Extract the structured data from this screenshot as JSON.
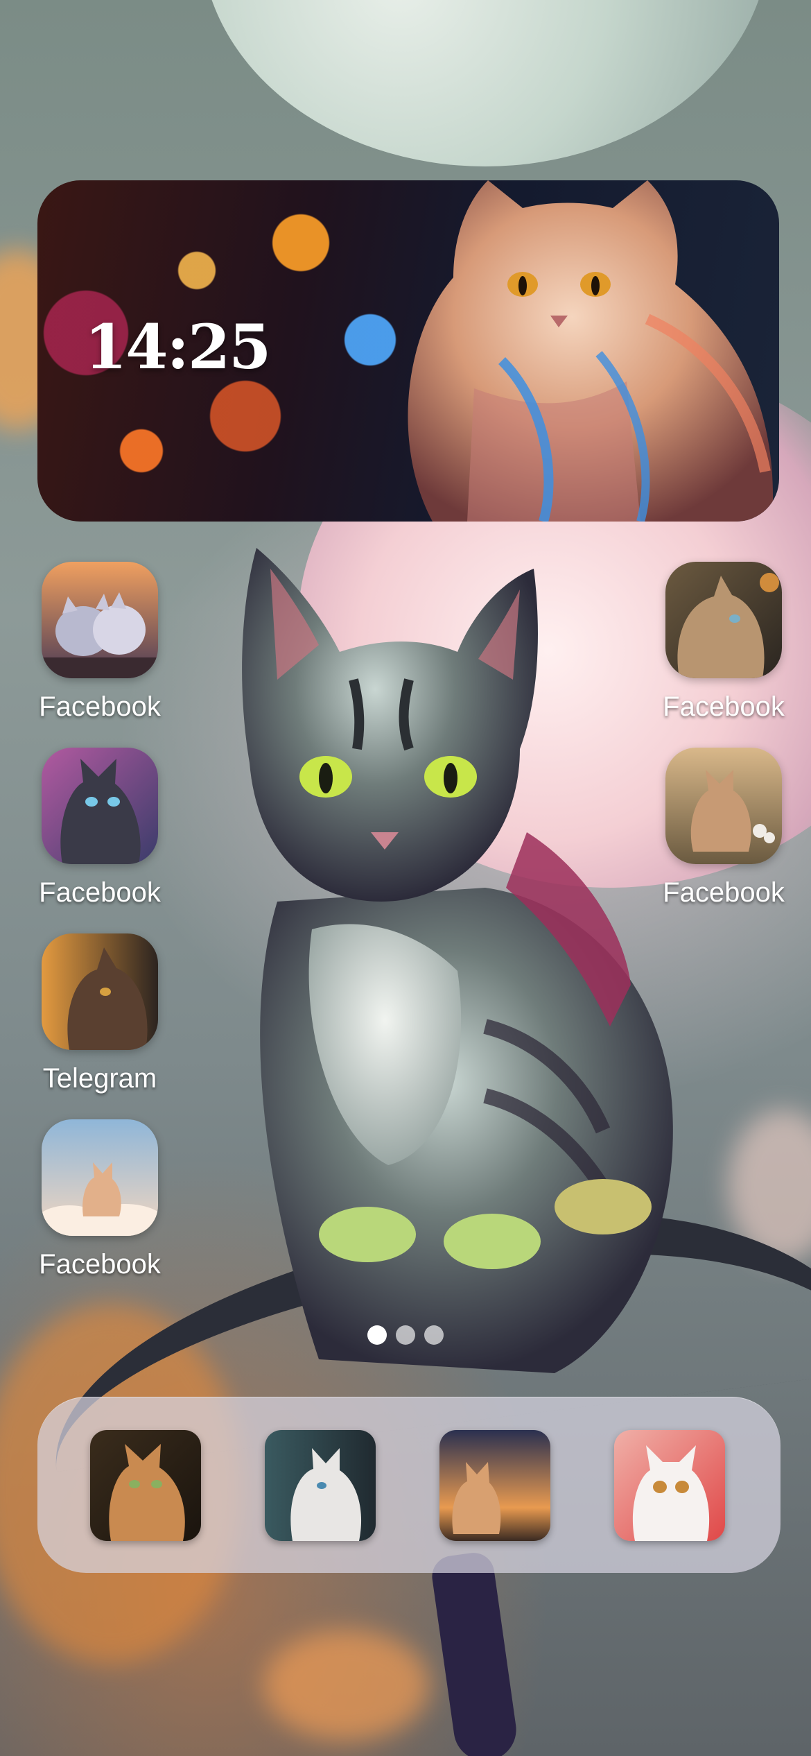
{
  "widget": {
    "time": "14:25",
    "photo_icon": "fluffy-cat-photo"
  },
  "home_apps": [
    {
      "label": "Facebook",
      "icon": "cats-cuddling-icon"
    },
    {
      "label": "Facebook",
      "icon": "tabby-cat-icon"
    },
    {
      "label": "Facebook",
      "icon": "dark-cat-icon"
    },
    {
      "label": "Facebook",
      "icon": "kitten-icon"
    },
    {
      "label": "Telegram",
      "icon": "brown-cat-icon"
    },
    {
      "label": "Facebook",
      "icon": "cloud-kitten-icon"
    }
  ],
  "page_dots": {
    "count": 3,
    "active_index": 0
  },
  "dock_apps": [
    {
      "icon": "ginger-cat-icon"
    },
    {
      "icon": "white-cat-icon"
    },
    {
      "icon": "sunset-kitten-icon"
    },
    {
      "icon": "white-kitten-icon"
    }
  ],
  "colors": {
    "label_text": "#ffffff",
    "dock_background": "#d7d4e1",
    "dot_active": "#ffffff"
  }
}
